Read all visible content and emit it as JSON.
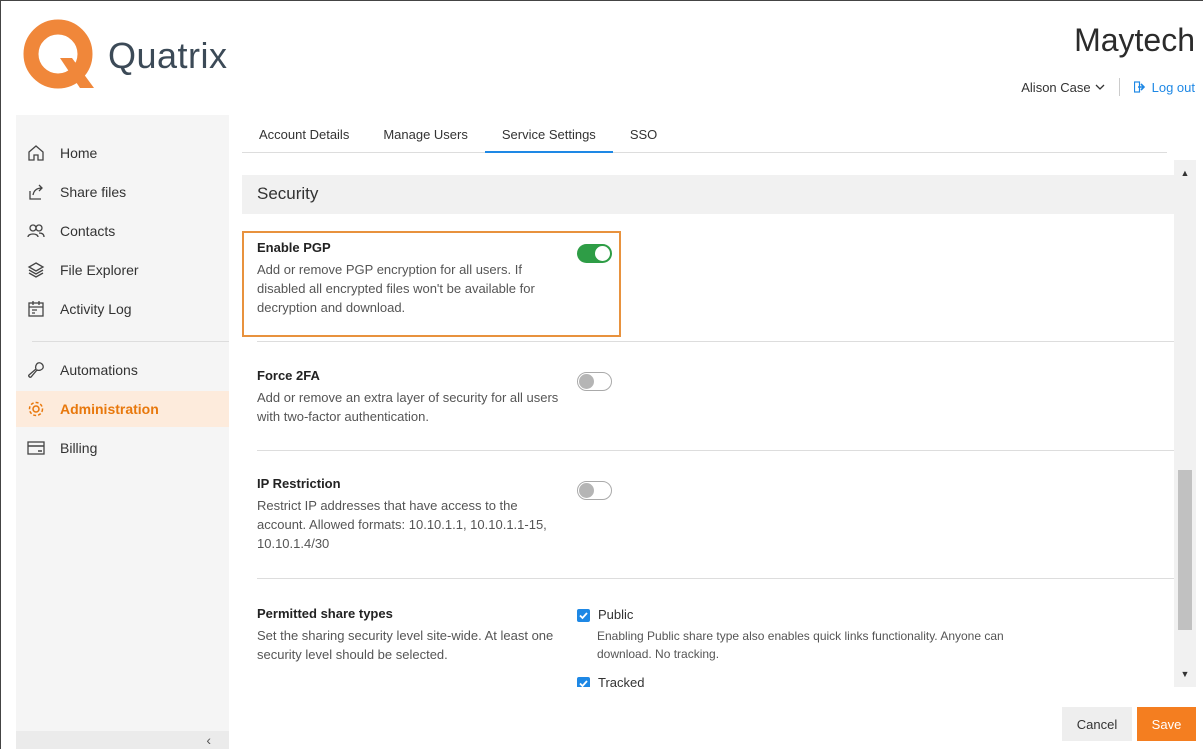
{
  "brand": {
    "logo_text": "Quatrix",
    "accent_color": "#f47e20",
    "logo_color": "#f0873a"
  },
  "header": {
    "org_name": "Maytech",
    "user_name": "Alison Case",
    "logout_label": "Log out"
  },
  "sidebar": {
    "items": [
      {
        "label": "Home",
        "icon": "home-icon"
      },
      {
        "label": "Share files",
        "icon": "share-icon"
      },
      {
        "label": "Contacts",
        "icon": "contacts-icon"
      },
      {
        "label": "File Explorer",
        "icon": "layers-icon"
      },
      {
        "label": "Activity Log",
        "icon": "calendar-icon"
      },
      {
        "label": "Automations",
        "icon": "wrench-icon"
      },
      {
        "label": "Administration",
        "icon": "gear-icon",
        "active": true
      },
      {
        "label": "Billing",
        "icon": "card-icon"
      }
    ],
    "collapse_glyph": "‹"
  },
  "tabs": [
    {
      "label": "Account Details"
    },
    {
      "label": "Manage Users"
    },
    {
      "label": "Service Settings",
      "active": true
    },
    {
      "label": "SSO"
    }
  ],
  "section": {
    "title": "Security"
  },
  "settings": {
    "pgp": {
      "title": "Enable PGP",
      "desc": "Add or remove PGP encryption for all users. If disabled all encrypted files won't be available for decryption and download.",
      "enabled": true
    },
    "twofa": {
      "title": "Force 2FA",
      "desc": "Add or remove an extra layer of security for all users with two-factor authentication.",
      "enabled": false
    },
    "ip": {
      "title": "IP Restriction",
      "desc": "Restrict IP addresses that have access to the account. Allowed formats: 10.10.1.1, 10.10.1.1-15, 10.10.1.4/30",
      "enabled": false
    },
    "share": {
      "title": "Permitted share types",
      "desc": "Set the sharing security level site-wide. At least one security level should be selected.",
      "options": [
        {
          "label": "Public",
          "checked": true,
          "desc": "Enabling Public share type also enables quick links functionality. Anyone can download. No tracking."
        },
        {
          "label": "Tracked",
          "checked": true
        }
      ]
    }
  },
  "footer": {
    "cancel_label": "Cancel",
    "save_label": "Save"
  }
}
